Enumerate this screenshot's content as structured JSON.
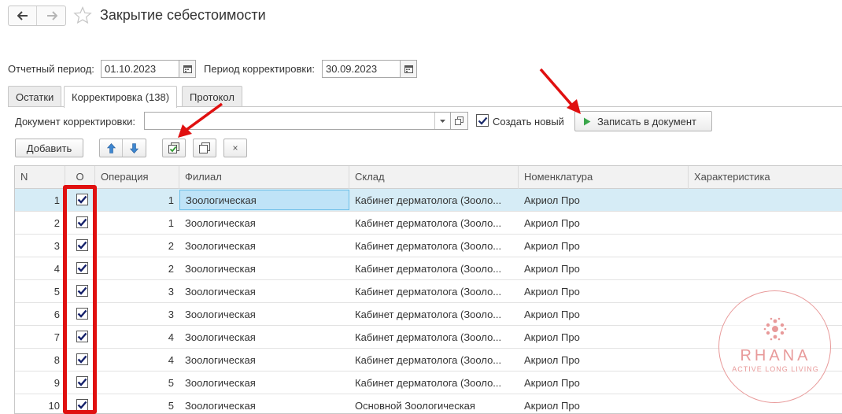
{
  "window": {
    "title": "Закрытие себестоимости"
  },
  "period": {
    "report_label": "Отчетный период:",
    "report_value": "01.10.2023",
    "correction_label": "Период корректировки:",
    "correction_value": "30.09.2023"
  },
  "tabs": [
    {
      "label": "Остатки"
    },
    {
      "label": "Корректировка (138)"
    },
    {
      "label": "Протокол"
    }
  ],
  "doc": {
    "label": "Документ корректировки:",
    "value": "",
    "create_new_label": "Создать новый",
    "create_new_checked": true,
    "write_button": "Записать в документ"
  },
  "toolbar": {
    "add_label": "Добавить",
    "close_label": "×"
  },
  "table": {
    "columns": [
      "N",
      "О",
      "Операция",
      "Филиал",
      "Склад",
      "Номенклатура",
      "Характеристика"
    ],
    "rows": [
      {
        "n": "1",
        "checked": true,
        "op": "1",
        "filial": "Зоологическая",
        "sklad": "Кабинет дерматолога (Зооло...",
        "nom": "Акриол Про",
        "har": ""
      },
      {
        "n": "2",
        "checked": true,
        "op": "1",
        "filial": "Зоологическая",
        "sklad": "Кабинет дерматолога (Зооло...",
        "nom": "Акриол Про",
        "har": ""
      },
      {
        "n": "3",
        "checked": true,
        "op": "2",
        "filial": "Зоологическая",
        "sklad": "Кабинет дерматолога (Зооло...",
        "nom": "Акриол Про",
        "har": ""
      },
      {
        "n": "4",
        "checked": true,
        "op": "2",
        "filial": "Зоологическая",
        "sklad": "Кабинет дерматолога (Зооло...",
        "nom": "Акриол Про",
        "har": ""
      },
      {
        "n": "5",
        "checked": true,
        "op": "3",
        "filial": "Зоологическая",
        "sklad": "Кабинет дерматолога (Зооло...",
        "nom": "Акриол Про",
        "har": ""
      },
      {
        "n": "6",
        "checked": true,
        "op": "3",
        "filial": "Зоологическая",
        "sklad": "Кабинет дерматолога (Зооло...",
        "nom": "Акриол Про",
        "har": ""
      },
      {
        "n": "7",
        "checked": true,
        "op": "4",
        "filial": "Зоологическая",
        "sklad": "Кабинет дерматолога (Зооло...",
        "nom": "Акриол Про",
        "har": ""
      },
      {
        "n": "8",
        "checked": true,
        "op": "4",
        "filial": "Зоологическая",
        "sklad": "Кабинет дерматолога (Зооло...",
        "nom": "Акриол Про",
        "har": ""
      },
      {
        "n": "9",
        "checked": true,
        "op": "5",
        "filial": "Зоологическая",
        "sklad": "Кабинет дерматолога (Зооло...",
        "nom": "Акриол Про",
        "har": ""
      },
      {
        "n": "10",
        "checked": true,
        "op": "5",
        "filial": "Зоологическая",
        "sklad": "Основной Зоологическая",
        "nom": "Акриол Про",
        "har": ""
      }
    ]
  },
  "watermark": {
    "brand": "RHANA",
    "tagline": "ACTIVE LONG LIVING"
  },
  "colors": {
    "accent": "#e01010",
    "selection": "#d6ecf6",
    "play": "#3aa64a",
    "arrow_blue": "#3d86d0",
    "watermark": "#e89a9a"
  }
}
